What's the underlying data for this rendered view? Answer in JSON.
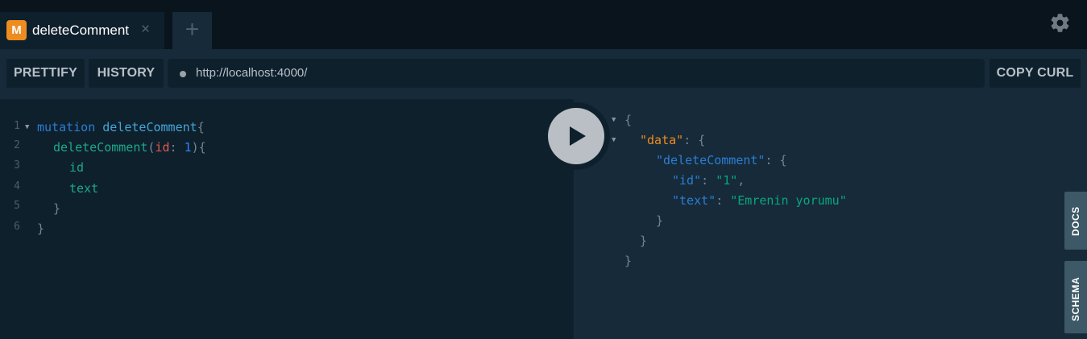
{
  "tab": {
    "badge": "M",
    "title": "deleteComment",
    "close": "×",
    "add": "+"
  },
  "toolbar": {
    "prettify": "PRETTIFY",
    "history": "HISTORY",
    "url": "http://localhost:4000/",
    "copy_curl": "COPY CURL"
  },
  "editor": {
    "line_numbers": [
      "1",
      "2",
      "3",
      "4",
      "5",
      "6"
    ],
    "l1": {
      "kw": "mutation",
      "name": "deleteComment",
      "brace": "{"
    },
    "l2": {
      "field": "deleteComment",
      "open": "(",
      "arg": "id",
      "colon": ": ",
      "value": "1",
      "close": "){"
    },
    "l3": {
      "field": "id"
    },
    "l4": {
      "field": "text"
    },
    "l5": {
      "brace": "}"
    },
    "l6": {
      "brace": "}"
    }
  },
  "result": {
    "open": "{",
    "data_key": "\"data\"",
    "colon": ": ",
    "brace_open": "{",
    "op_key": "\"deleteComment\"",
    "id_key": "\"id\"",
    "id_val": "\"1\"",
    "comma": ",",
    "text_key": "\"text\"",
    "text_val": "\"Emrenin yorumu\"",
    "close": "}"
  },
  "side": {
    "docs": "DOCS",
    "schema": "SCHEMA"
  },
  "icons": {
    "settings": "gear-icon",
    "play": "play-icon"
  },
  "colors": {
    "accent": "#ee8c20",
    "background": "#0f202d",
    "panel": "#172a3a"
  }
}
